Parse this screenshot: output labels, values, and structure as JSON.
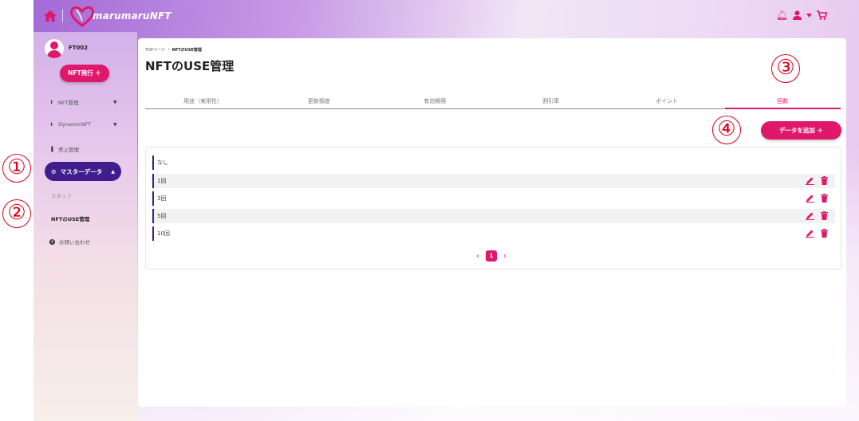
{
  "topbar": {
    "logo_text": "marumaruNFT",
    "icons": [
      "home-icon",
      "bell-icon",
      "user-icon",
      "caret-down-icon",
      "cart-icon"
    ]
  },
  "sidebar": {
    "username": "FT002",
    "issue_button": "NFT発行 ＋",
    "items": [
      {
        "label": "NFT管理",
        "icon": "rocket-icon"
      },
      {
        "label": "DynamicNFT",
        "icon": "rocket-icon"
      },
      {
        "label": "売上管理",
        "icon": "chart-icon"
      }
    ],
    "master_data": "マスターデータ",
    "sub_items": [
      "スタッフ",
      "NFTのUSE管理"
    ],
    "contact": "お問い合わせ"
  },
  "content": {
    "breadcrumb": {
      "home": "TOPページ",
      "sep": "/",
      "current": "NFTのUSE管理"
    },
    "title": "NFTのUSE管理",
    "tabs": [
      "用途（実用性）",
      "更新頻度",
      "有効期限",
      "割引率",
      "ポイント",
      "回数"
    ],
    "active_tab": "回数",
    "add_button": "データを追加 ＋",
    "rows": [
      "なし",
      "1回",
      "3回",
      "5回",
      "10回"
    ],
    "pagination": {
      "prev": "‹",
      "current": "1",
      "next": "›"
    }
  },
  "annotations": [
    "①",
    "②",
    "③",
    "④"
  ],
  "colors": {
    "accent": "#e0186c",
    "master": "#3f1d8c",
    "annotation": "#e0001b"
  }
}
